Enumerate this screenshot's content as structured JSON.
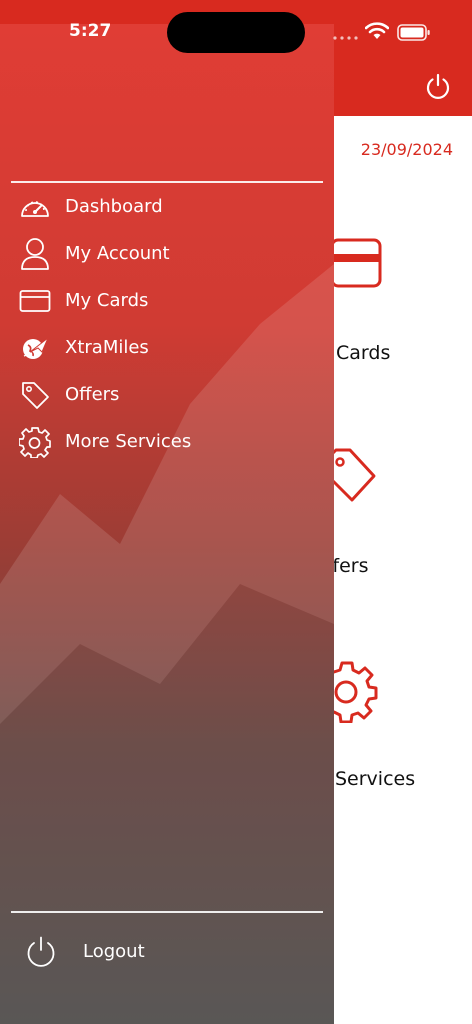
{
  "status_bar": {
    "time": "5:27"
  },
  "app": {
    "header_color": "#d82a1f",
    "date": "23/09/2024",
    "tiles": [
      {
        "icon": "credit-card-icon",
        "label": "Cards"
      },
      {
        "icon": "tag-icon",
        "label": "ffers"
      },
      {
        "icon": "gear-icon",
        "label": "Services"
      }
    ]
  },
  "drawer": {
    "menu": [
      {
        "icon": "speedometer-icon",
        "label": "Dashboard"
      },
      {
        "icon": "user-icon",
        "label": "My Account"
      },
      {
        "icon": "credit-card-icon",
        "label": "My Cards"
      },
      {
        "icon": "plane-globe-icon",
        "label": "XtraMiles"
      },
      {
        "icon": "tag-icon",
        "label": "Offers"
      },
      {
        "icon": "gear-icon",
        "label": "More Services"
      }
    ],
    "logout": {
      "icon": "power-icon",
      "label": "Logout"
    }
  }
}
